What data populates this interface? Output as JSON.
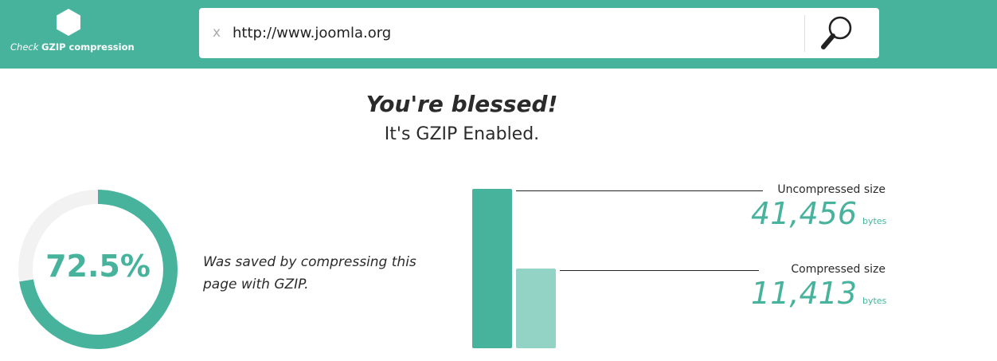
{
  "header": {
    "logo_prefix": "Check",
    "logo_name": "GZIP compression",
    "clear_label": "x",
    "url_value": "http://www.joomla.org",
    "icons": {
      "logo": "hexagon-logo-icon",
      "search": "magnifier-icon"
    }
  },
  "result": {
    "headline": "You're blessed!",
    "subline": "It's GZIP Enabled."
  },
  "savings": {
    "percent_text": "72.5%",
    "percent": 72.5,
    "description": "Was saved by compressing this page with GZIP."
  },
  "sizes": {
    "uncompressed": {
      "label": "Uncompressed size",
      "value_text": "41,456",
      "unit": "bytes",
      "bytes": 41456
    },
    "compressed": {
      "label": "Compressed size",
      "value_text": "11,413",
      "unit": "bytes",
      "bytes": 11413
    }
  },
  "colors": {
    "brand": "#47b39d",
    "bar_light": "#92d3c6",
    "ring_track": "#f2f2f2"
  }
}
